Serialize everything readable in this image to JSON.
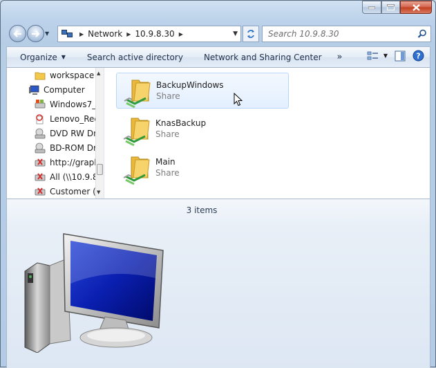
{
  "window": {
    "caption_buttons": [
      "minimize",
      "maximize",
      "close"
    ]
  },
  "navigation": {
    "address": {
      "crumbs": [
        "Network",
        "10.9.8.30"
      ],
      "root_icon": "network-icon"
    },
    "search": {
      "placeholder": "Search 10.9.8.30"
    }
  },
  "toolbar": {
    "organize": "Organize",
    "search_ad": "Search active directory",
    "nsc": "Network and Sharing Center",
    "more": "»"
  },
  "sidebar": {
    "items": [
      {
        "label": "workspace",
        "icon": "folder-icon"
      },
      {
        "label": "Computer",
        "icon": "computer-icon"
      },
      {
        "label": "Windows7_",
        "icon": "drive-icon"
      },
      {
        "label": "Lenovo_Rec",
        "icon": "drive-icon"
      },
      {
        "label": "DVD RW Dri",
        "icon": "optical-drive-icon"
      },
      {
        "label": "BD-ROM Dr",
        "icon": "optical-drive-icon"
      },
      {
        "label": "http://grapl",
        "icon": "disconnected-drive-icon"
      },
      {
        "label": "All (\\\\10.9.8",
        "icon": "disconnected-drive-icon"
      },
      {
        "label": "Customer (",
        "icon": "disconnected-drive-icon"
      }
    ]
  },
  "files": [
    {
      "name": "BackupWindows",
      "type": "Share",
      "selected": true
    },
    {
      "name": "KnasBackup",
      "type": "Share",
      "selected": false
    },
    {
      "name": "Main",
      "type": "Share",
      "selected": false
    }
  ],
  "status": {
    "count": "3 items"
  },
  "colors": {
    "selection": "#e3efff",
    "selection_border": "#b8d6fb",
    "toolbar_text": "#1e2f49"
  }
}
